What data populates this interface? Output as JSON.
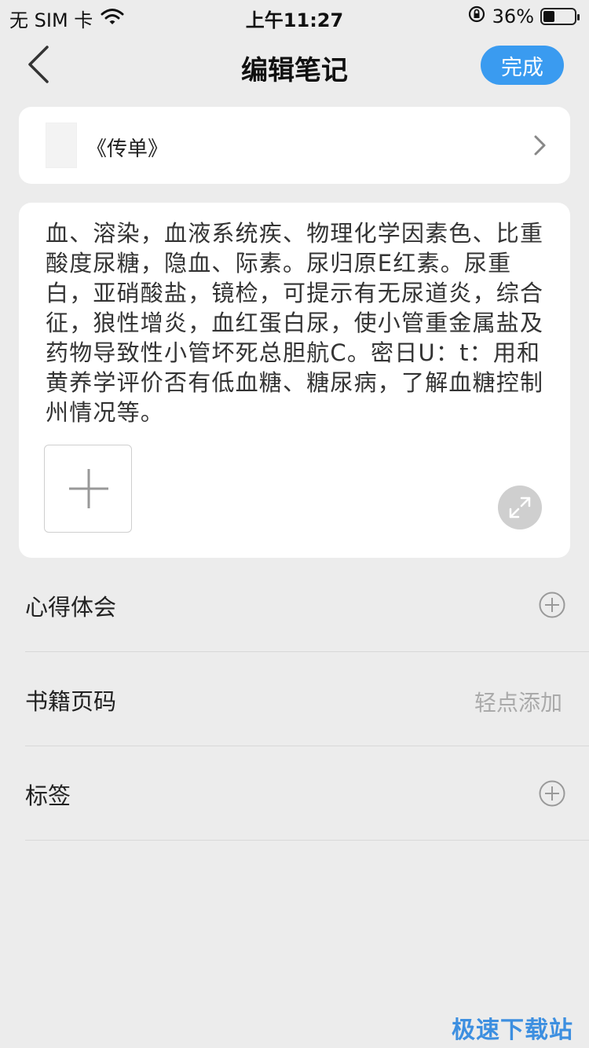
{
  "status_bar": {
    "carrier": "无 SIM 卡",
    "time": "上午11:27",
    "battery_percent_text": "36%",
    "battery_level": 0.36
  },
  "nav": {
    "title": "编辑笔记",
    "done_label": "完成"
  },
  "book": {
    "title": "《传单》"
  },
  "note": {
    "content": "血、溶染，血液系统疾、物理化学因素色、比重酸度尿糖，隐血、际素。尿归原E红素。尿重白，亚硝酸盐，镜检，可提示有无尿道炎，综合征，狼性增炎，血红蛋白尿，使小管重金属盐及药物导致性小管坏死总胆航C。密日U：t：用和黄养学评价否有低血糖、糖尿病，了解血糖控制州情况等。"
  },
  "rows": {
    "insight_label": "心得体会",
    "page_label": "书籍页码",
    "page_hint": "轻点添加",
    "tags_label": "标签"
  },
  "watermark": "极速下载站",
  "colors": {
    "accent": "#3a9bf0",
    "background": "#ececec"
  },
  "icons": {
    "back": "chevron-left-icon",
    "chevron": "chevron-right-icon",
    "add": "plus-icon",
    "expand": "expand-icon",
    "wifi": "wifi-icon",
    "lock": "rotation-lock-icon",
    "battery": "battery-icon"
  }
}
